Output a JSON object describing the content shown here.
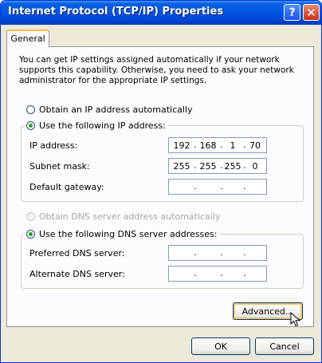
{
  "window": {
    "title": "Internet Protocol (TCP/IP) Properties",
    "help": "?",
    "close": "✕"
  },
  "tabs": [
    {
      "label": "General"
    }
  ],
  "intro": "You can get IP settings assigned automatically if your network supports this capability. Otherwise, you need to ask your network administrator for the appropriate IP settings.",
  "ip": {
    "auto_label": "Obtain an IP address automatically",
    "manual_label": "Use the following IP address:",
    "selected": "manual",
    "fields": [
      {
        "label": "IP address:",
        "octets": [
          "192",
          "168",
          "1",
          "70"
        ]
      },
      {
        "label": "Subnet mask:",
        "octets": [
          "255",
          "255",
          "255",
          "0"
        ]
      },
      {
        "label": "Default gateway:",
        "octets": [
          "",
          "",
          "",
          ""
        ]
      }
    ]
  },
  "dns": {
    "auto_label": "Obtain DNS server address automatically",
    "manual_label": "Use the following DNS server addresses:",
    "selected": "manual",
    "fields": [
      {
        "label": "Preferred DNS server:",
        "octets": [
          "",
          "",
          "",
          ""
        ]
      },
      {
        "label": "Alternate DNS server:",
        "octets": [
          "",
          "",
          "",
          ""
        ]
      }
    ]
  },
  "buttons": {
    "advanced": "Advanced...",
    "ok": "OK",
    "cancel": "Cancel"
  },
  "separator": "."
}
